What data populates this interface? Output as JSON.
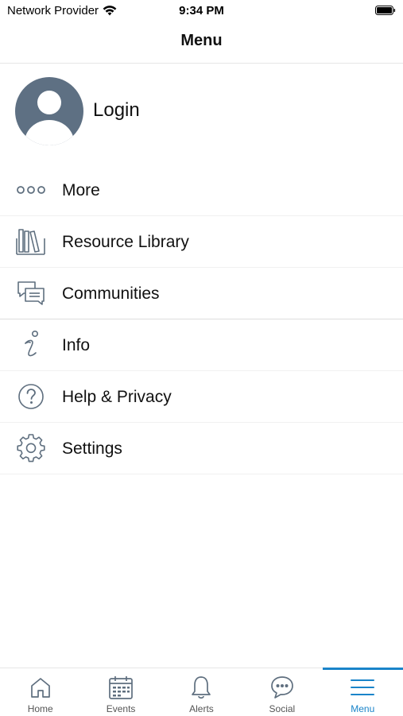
{
  "status_bar": {
    "carrier": "Network Provider",
    "time": "9:34 PM"
  },
  "nav": {
    "title": "Menu"
  },
  "profile": {
    "login_label": "Login"
  },
  "menu": {
    "items": [
      {
        "label": "More",
        "icon": "more-dots-icon"
      },
      {
        "label": "Resource Library",
        "icon": "books-icon"
      },
      {
        "label": "Communities",
        "icon": "chat-bubbles-icon"
      },
      {
        "label": "Info",
        "icon": "info-icon"
      },
      {
        "label": "Help & Privacy",
        "icon": "help-circle-icon"
      },
      {
        "label": "Settings",
        "icon": "gear-icon"
      }
    ]
  },
  "tabs": [
    {
      "label": "Home",
      "icon": "home-icon"
    },
    {
      "label": "Events",
      "icon": "calendar-icon"
    },
    {
      "label": "Alerts",
      "icon": "bell-icon"
    },
    {
      "label": "Social",
      "icon": "speech-bubble-icon"
    },
    {
      "label": "Menu",
      "icon": "hamburger-icon",
      "active": true
    }
  ],
  "colors": {
    "accent": "#1a84c9",
    "icon_gray": "#5f6f7f",
    "avatar_bg": "#5e7083"
  }
}
